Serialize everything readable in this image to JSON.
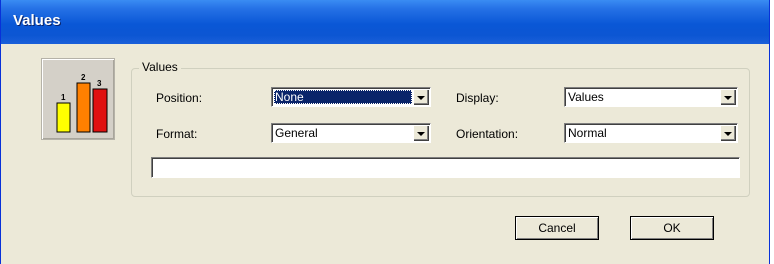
{
  "window": {
    "title": "Values"
  },
  "group": {
    "legend": "Values"
  },
  "fields": {
    "position": {
      "label": "Position:",
      "value": "None"
    },
    "display": {
      "label": "Display:",
      "value": "Values"
    },
    "format": {
      "label": "Format:",
      "value": "General"
    },
    "orientation": {
      "label": "Orientation:",
      "value": "Normal"
    },
    "text_value": ""
  },
  "icon": {
    "name": "bar-chart-icon",
    "bars": [
      {
        "label": "1",
        "color": "#ffff00"
      },
      {
        "label": "2",
        "color": "#ff8000"
      },
      {
        "label": "3",
        "color": "#e01010"
      }
    ]
  },
  "buttons": {
    "cancel": "Cancel",
    "ok": "OK"
  },
  "colors": {
    "titlebar": "#0a57d6",
    "dialog": "#ece9d8",
    "selection": "#0a246a"
  }
}
